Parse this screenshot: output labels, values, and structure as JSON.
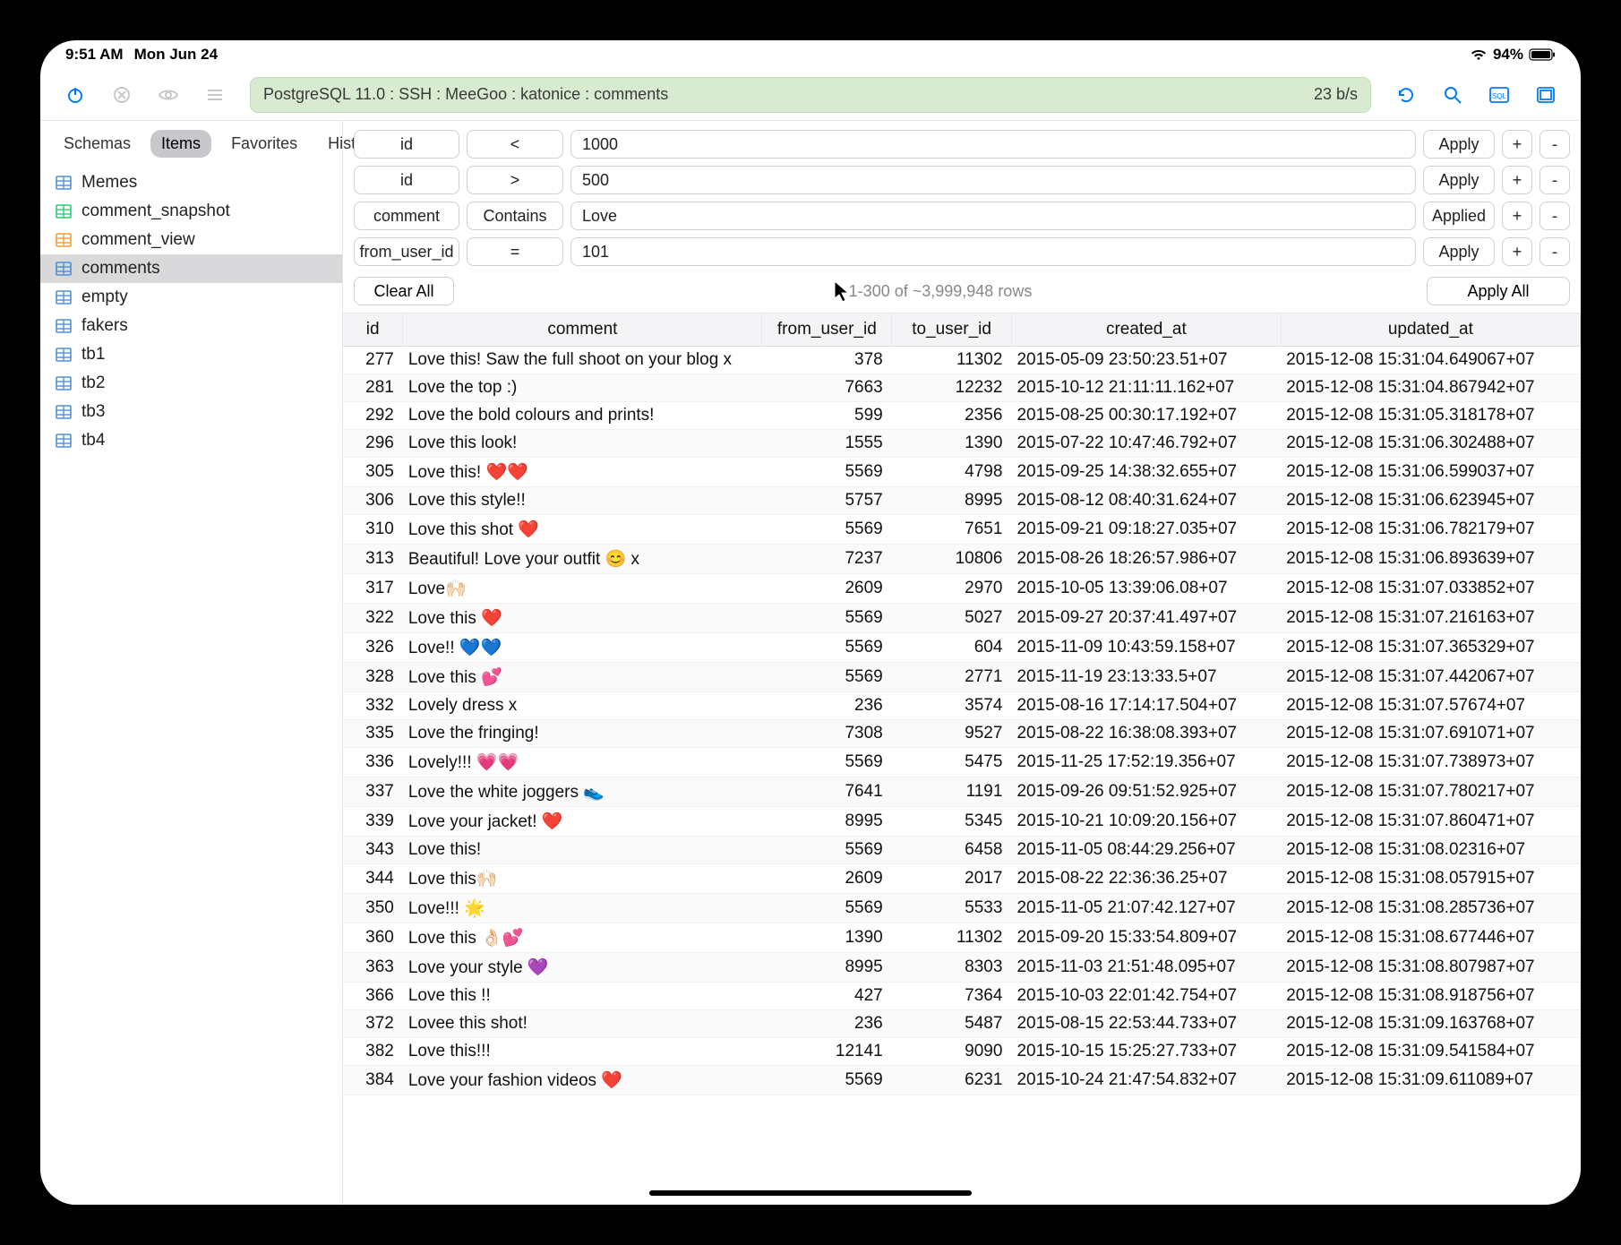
{
  "status_bar": {
    "time": "9:51 AM",
    "date": "Mon Jun 24",
    "battery_pct": "94%"
  },
  "toolbar": {
    "breadcrumb": "PostgreSQL 11.0 : SSH : MeeGoo : katonice : comments",
    "speed": "23 b/s"
  },
  "sidebar": {
    "tabs": {
      "schemas": "Schemas",
      "items": "Items",
      "favorites": "Favorites",
      "history": "History"
    },
    "items": [
      {
        "label": "Memes",
        "icon": "table"
      },
      {
        "label": "comment_snapshot",
        "icon": "snap"
      },
      {
        "label": "comment_view",
        "icon": "view"
      },
      {
        "label": "comments",
        "icon": "table",
        "selected": true
      },
      {
        "label": "empty",
        "icon": "table"
      },
      {
        "label": "fakers",
        "icon": "table"
      },
      {
        "label": "tb1",
        "icon": "table"
      },
      {
        "label": "tb2",
        "icon": "table"
      },
      {
        "label": "tb3",
        "icon": "table"
      },
      {
        "label": "tb4",
        "icon": "table"
      }
    ]
  },
  "filters": {
    "rows": [
      {
        "field": "id",
        "op": "<",
        "value": "1000",
        "state": "Apply"
      },
      {
        "field": "id",
        "op": ">",
        "value": "500",
        "state": "Apply"
      },
      {
        "field": "comment",
        "op": "Contains",
        "value": "Love",
        "state": "Applied"
      },
      {
        "field": "from_user_id",
        "op": "=",
        "value": "101",
        "state": "Apply"
      }
    ],
    "clear_label": "Clear All",
    "count_label": "1-300 of ~3,999,948 rows",
    "apply_all_label": "Apply All",
    "plus": "+",
    "minus": "-"
  },
  "table": {
    "headers": {
      "id": "id",
      "comment": "comment",
      "from": "from_user_id",
      "to": "to_user_id",
      "created": "created_at",
      "updated": "updated_at"
    },
    "rows": [
      {
        "id": "277",
        "comment": "Love this! Saw the full shoot on your blog x",
        "from": "378",
        "to": "11302",
        "created": "2015-05-09 23:50:23.51+07",
        "updated": "2015-12-08 15:31:04.649067+07"
      },
      {
        "id": "281",
        "comment": "Love the top :)",
        "from": "7663",
        "to": "12232",
        "created": "2015-10-12 21:11:11.162+07",
        "updated": "2015-12-08 15:31:04.867942+07"
      },
      {
        "id": "292",
        "comment": "Love the bold colours and prints!",
        "from": "599",
        "to": "2356",
        "created": "2015-08-25 00:30:17.192+07",
        "updated": "2015-12-08 15:31:05.318178+07"
      },
      {
        "id": "296",
        "comment": "Love this look!",
        "from": "1555",
        "to": "1390",
        "created": "2015-07-22 10:47:46.792+07",
        "updated": "2015-12-08 15:31:06.302488+07"
      },
      {
        "id": "305",
        "comment": "Love this! ❤️❤️",
        "from": "5569",
        "to": "4798",
        "created": "2015-09-25 14:38:32.655+07",
        "updated": "2015-12-08 15:31:06.599037+07"
      },
      {
        "id": "306",
        "comment": "Love this style!!",
        "from": "5757",
        "to": "8995",
        "created": "2015-08-12 08:40:31.624+07",
        "updated": "2015-12-08 15:31:06.623945+07"
      },
      {
        "id": "310",
        "comment": "Love this shot ❤️",
        "from": "5569",
        "to": "7651",
        "created": "2015-09-21 09:18:27.035+07",
        "updated": "2015-12-08 15:31:06.782179+07"
      },
      {
        "id": "313",
        "comment": "Beautiful! Love your outfit 😊 x",
        "from": "7237",
        "to": "10806",
        "created": "2015-08-26 18:26:57.986+07",
        "updated": "2015-12-08 15:31:06.893639+07"
      },
      {
        "id": "317",
        "comment": " Love🙌🏻",
        "from": "2609",
        "to": "2970",
        "created": "2015-10-05 13:39:06.08+07",
        "updated": "2015-12-08 15:31:07.033852+07"
      },
      {
        "id": "322",
        "comment": "Love this ❤️",
        "from": "5569",
        "to": "5027",
        "created": "2015-09-27 20:37:41.497+07",
        "updated": "2015-12-08 15:31:07.216163+07"
      },
      {
        "id": "326",
        "comment": "Love!! 💙💙",
        "from": "5569",
        "to": "604",
        "created": "2015-11-09 10:43:59.158+07",
        "updated": "2015-12-08 15:31:07.365329+07"
      },
      {
        "id": "328",
        "comment": "Love this 💕",
        "from": "5569",
        "to": "2771",
        "created": "2015-11-19 23:13:33.5+07",
        "updated": "2015-12-08 15:31:07.442067+07"
      },
      {
        "id": "332",
        "comment": "Lovely dress x",
        "from": "236",
        "to": "3574",
        "created": "2015-08-16 17:14:17.504+07",
        "updated": "2015-12-08 15:31:07.57674+07"
      },
      {
        "id": "335",
        "comment": "Love the fringing!",
        "from": "7308",
        "to": "9527",
        "created": "2015-08-22 16:38:08.393+07",
        "updated": "2015-12-08 15:31:07.691071+07"
      },
      {
        "id": "336",
        "comment": "Lovely!!! 💗💗",
        "from": "5569",
        "to": "5475",
        "created": "2015-11-25 17:52:19.356+07",
        "updated": "2015-12-08 15:31:07.738973+07"
      },
      {
        "id": "337",
        "comment": "Love the white joggers 👟",
        "from": "7641",
        "to": "1191",
        "created": "2015-09-26 09:51:52.925+07",
        "updated": "2015-12-08 15:31:07.780217+07"
      },
      {
        "id": "339",
        "comment": "Love your jacket! ❤️",
        "from": "8995",
        "to": "5345",
        "created": "2015-10-21 10:09:20.156+07",
        "updated": "2015-12-08 15:31:07.860471+07"
      },
      {
        "id": "343",
        "comment": "Love this!",
        "from": "5569",
        "to": "6458",
        "created": "2015-11-05 08:44:29.256+07",
        "updated": "2015-12-08 15:31:08.02316+07"
      },
      {
        "id": "344",
        "comment": "Love this🙌🏻",
        "from": "2609",
        "to": "2017",
        "created": "2015-08-22 22:36:36.25+07",
        "updated": "2015-12-08 15:31:08.057915+07"
      },
      {
        "id": "350",
        "comment": "Love!!! 🌟",
        "from": "5569",
        "to": "5533",
        "created": "2015-11-05 21:07:42.127+07",
        "updated": "2015-12-08 15:31:08.285736+07"
      },
      {
        "id": "360",
        "comment": "Love this 👌🏻💕",
        "from": "1390",
        "to": "11302",
        "created": "2015-09-20 15:33:54.809+07",
        "updated": "2015-12-08 15:31:08.677446+07"
      },
      {
        "id": "363",
        "comment": "Love your style 💜",
        "from": "8995",
        "to": "8303",
        "created": "2015-11-03 21:51:48.095+07",
        "updated": "2015-12-08 15:31:08.807987+07"
      },
      {
        "id": "366",
        "comment": "Love this !!",
        "from": "427",
        "to": "7364",
        "created": "2015-10-03 22:01:42.754+07",
        "updated": "2015-12-08 15:31:08.918756+07"
      },
      {
        "id": "372",
        "comment": "Lovee this shot!",
        "from": "236",
        "to": "5487",
        "created": "2015-08-15 22:53:44.733+07",
        "updated": "2015-12-08 15:31:09.163768+07"
      },
      {
        "id": "382",
        "comment": "Love this!!!",
        "from": "12141",
        "to": "9090",
        "created": "2015-10-15 15:25:27.733+07",
        "updated": "2015-12-08 15:31:09.541584+07"
      },
      {
        "id": "384",
        "comment": "Love your fashion videos ❤️",
        "from": "5569",
        "to": "6231",
        "created": "2015-10-24 21:47:54.832+07",
        "updated": "2015-12-08 15:31:09.611089+07"
      }
    ]
  }
}
